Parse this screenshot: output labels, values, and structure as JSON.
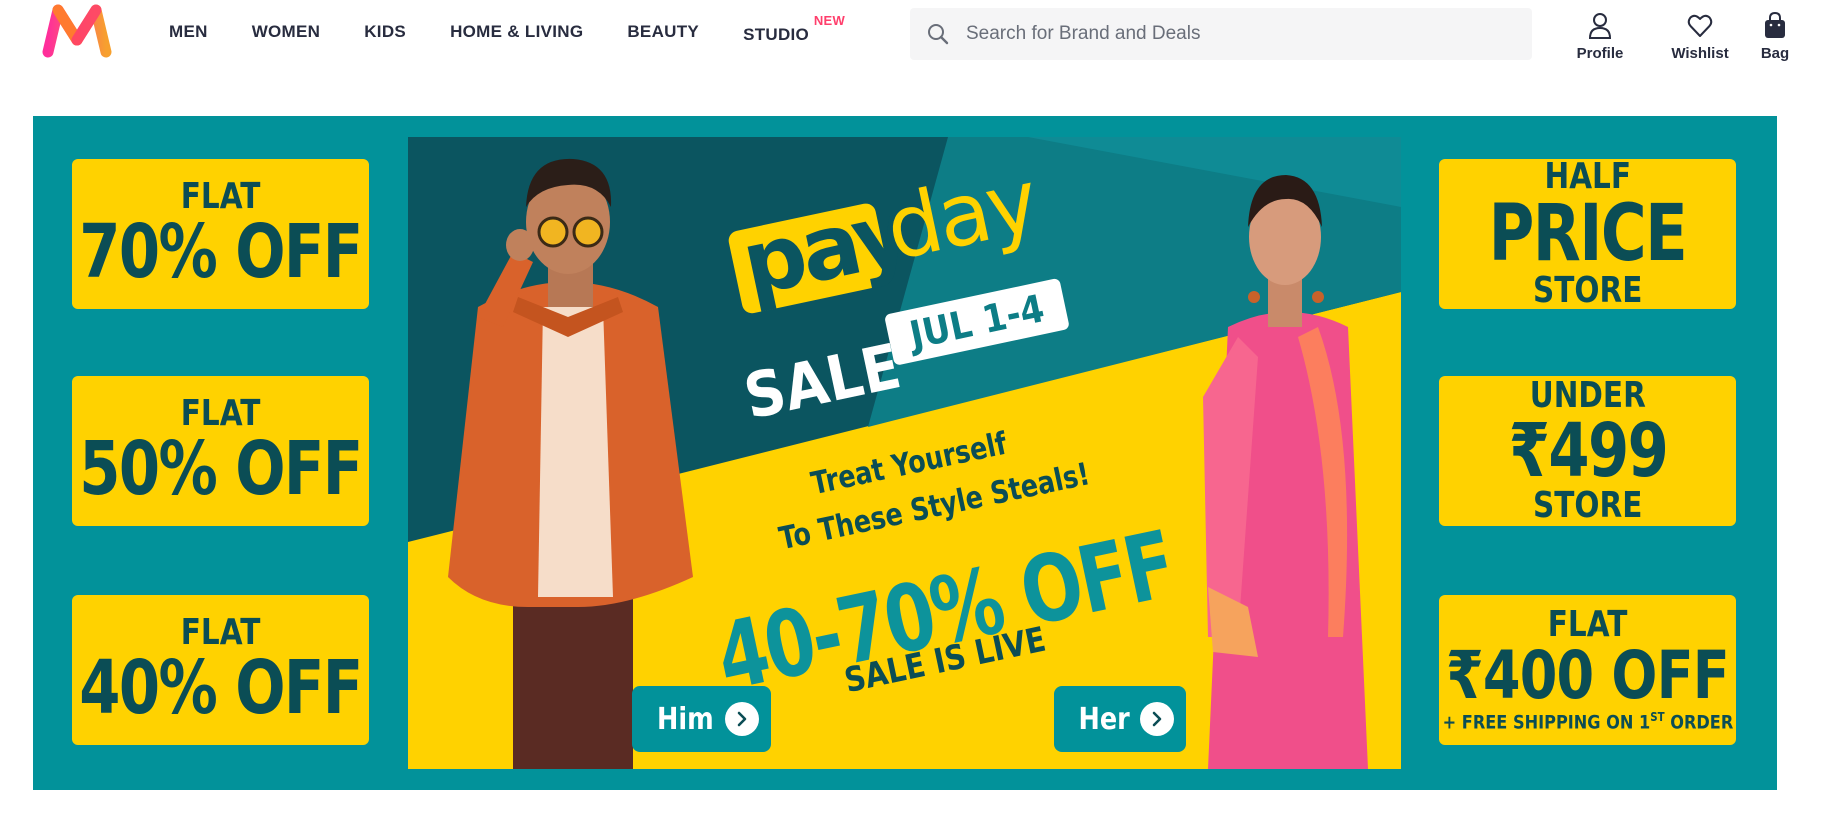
{
  "brand": {
    "logo_icon": "myntra-m-logo"
  },
  "nav": {
    "items": [
      {
        "label": "MEN"
      },
      {
        "label": "WOMEN"
      },
      {
        "label": "KIDS"
      },
      {
        "label": "HOME & LIVING"
      },
      {
        "label": "BEAUTY"
      },
      {
        "label": "STUDIO",
        "badge": "NEW"
      }
    ]
  },
  "search": {
    "placeholder": "Search for Brand and Deals",
    "value": "",
    "icon": "search-icon"
  },
  "actions": [
    {
      "label": "Profile",
      "icon": "profile-icon"
    },
    {
      "label": "Wishlist",
      "icon": "heart-icon"
    },
    {
      "label": "Bag",
      "icon": "bag-icon"
    }
  ],
  "banner": {
    "left_tiles": [
      {
        "line1": "FLAT",
        "line2": "70% OFF"
      },
      {
        "line1": "FLAT",
        "line2": "50% OFF"
      },
      {
        "line1": "FLAT",
        "line2": "40% OFF"
      }
    ],
    "right_tiles": {
      "half": {
        "line1": "HALF",
        "line2": "PRICE",
        "line3": "STORE"
      },
      "under": {
        "line1": "UNDER",
        "line2": "₹499",
        "line3": "STORE"
      },
      "flat400": {
        "line1": "FLAT",
        "line2": "₹400 OFF",
        "line3": "+ FREE SHIPPING ON 1",
        "sup": "ST",
        "line3_end": " ORDER"
      }
    },
    "center": {
      "pay": "pay",
      "day": "day",
      "sale": "SALE",
      "dates": "JUL 1-4",
      "tagline1": "Treat Yourself",
      "tagline2": "To These Style Steals!",
      "discount": "40-70% OFF",
      "live": "SALE IS LIVE",
      "cta_him": "Him",
      "cta_her": "Her"
    }
  },
  "colors": {
    "accent_pink": "#ff3f6c",
    "banner_teal": "#02929a",
    "banner_yellow": "#ffd200",
    "text_dark_teal": "#0b4d55",
    "nav_text": "#282c3f"
  }
}
